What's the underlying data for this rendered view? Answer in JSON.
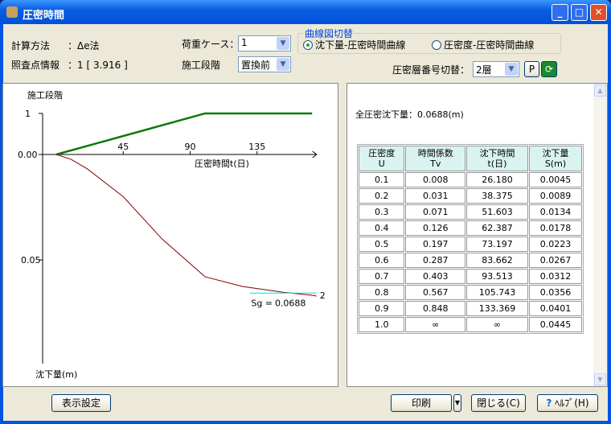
{
  "window": {
    "title": "圧密時間"
  },
  "info": {
    "method_label": "計算方法",
    "method_value": "：Δe法",
    "point_label": "照査点情報",
    "point_value": "：1 [ 3.916 ]"
  },
  "load_case": {
    "label": "荷重ケース：",
    "value": "1"
  },
  "stage": {
    "label": "施工段階",
    "value": "置換前"
  },
  "curve_switch": {
    "legend": "曲線図切替",
    "options": [
      {
        "label": "沈下量-圧密時間曲線",
        "selected": true
      },
      {
        "label": "圧密度-圧密時間曲線",
        "selected": false
      }
    ]
  },
  "layer_switch": {
    "label": "圧密層番号切替：",
    "value": "2層",
    "p_label": "P"
  },
  "total": "全圧密沈下量：0.0688(m)",
  "table": {
    "headers": [
      [
        "圧密度",
        "U"
      ],
      [
        "時間係数",
        "Tv"
      ],
      [
        "沈下時間",
        "t(日)"
      ],
      [
        "沈下量",
        "S(m)"
      ]
    ],
    "rows": [
      [
        "0.1",
        "0.008",
        "26.180",
        "0.0045"
      ],
      [
        "0.2",
        "0.031",
        "38.375",
        "0.0089"
      ],
      [
        "0.3",
        "0.071",
        "51.603",
        "0.0134"
      ],
      [
        "0.4",
        "0.126",
        "62.387",
        "0.0178"
      ],
      [
        "0.5",
        "0.197",
        "73.197",
        "0.0223"
      ],
      [
        "0.6",
        "0.287",
        "83.662",
        "0.0267"
      ],
      [
        "0.7",
        "0.403",
        "93.513",
        "0.0312"
      ],
      [
        "0.8",
        "0.567",
        "105.743",
        "0.0356"
      ],
      [
        "0.9",
        "0.848",
        "133.369",
        "0.0401"
      ],
      [
        "1.0",
        "∞",
        "∞",
        "0.0445"
      ]
    ]
  },
  "buttons": {
    "display": "表示設定",
    "print": "印刷",
    "close": "閉じる(C)",
    "help": "ﾍﾙﾌﾟ(H)"
  },
  "chart_data": {
    "type": "line",
    "title": "",
    "stage_label": "施工段階",
    "xlabel": "圧密時間t(日)",
    "ylabel": "沈下量(m)",
    "xticks": [
      45,
      90,
      135
    ],
    "stage_ticks": [
      "1"
    ],
    "yticks": [
      "0.00",
      "0.05"
    ],
    "xlim": [
      0,
      175
    ],
    "ylim": [
      0,
      0.1
    ],
    "stage_series": {
      "name": "施工段階",
      "t": [
        0,
        100,
        172
      ],
      "v": [
        0,
        1,
        1
      ],
      "color": "#0a7a0a"
    },
    "settlement_series": {
      "name": "沈下量",
      "t": [
        0,
        10,
        21,
        45,
        71,
        100,
        125,
        152,
        172
      ],
      "s": [
        0,
        0.0023,
        0.0069,
        0.02,
        0.04,
        0.058,
        0.0626,
        0.0653,
        0.0668
      ],
      "color": "#800000"
    },
    "final": {
      "label": "Sg =",
      "value": "0.0688",
      "layer": "2",
      "color": "#00e0e0"
    }
  }
}
